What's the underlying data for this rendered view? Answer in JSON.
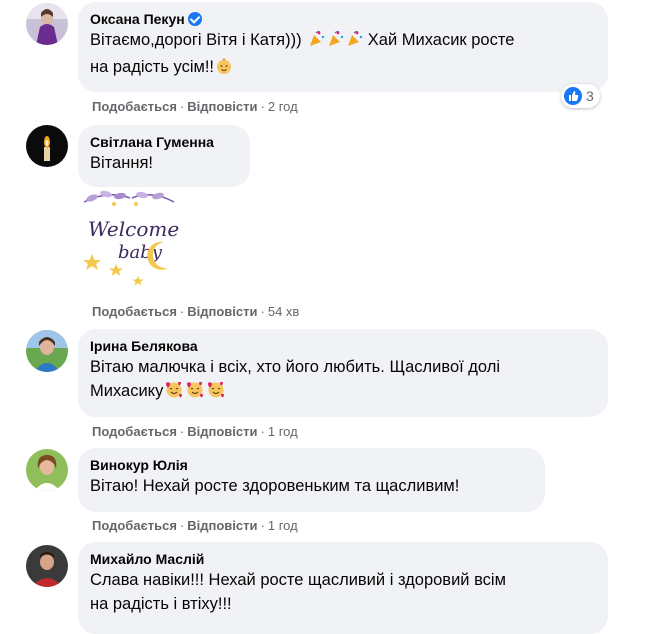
{
  "ui": {
    "like_label": "Подобається",
    "reply_label": "Відповісти",
    "dot": "·"
  },
  "colors": {
    "bubble_bg": "#f0f2f5",
    "meta_text": "#65676b",
    "verified_blue": "#1877f2"
  },
  "comments": [
    {
      "author": "Оксана Пекун",
      "verified": true,
      "line1": "Вітаємо,дорогі Вітя і Катя)))",
      "line1_tail": "Хай Михасик росте",
      "line2": "на радість усім!!",
      "time": "2 год",
      "reactions": "3",
      "emoji": [
        "party-popper-icon",
        "party-popper-icon",
        "party-popper-icon",
        "baby-face-icon"
      ]
    },
    {
      "author": "Світлана Гуменна",
      "line1": "Вітання!",
      "time": "54 хв",
      "sticker": {
        "line1": "Welcome",
        "line2": "baby"
      }
    },
    {
      "author": "Ірина Белякова",
      "line1": "Вітаю малючка і всіх, хто його любить. Щасливої долі",
      "line2": "Михасику",
      "time": "1 год",
      "emoji": [
        "smiling-face-with-hearts-icon",
        "smiling-face-with-hearts-icon",
        "smiling-face-with-hearts-icon"
      ]
    },
    {
      "author": "Винокур Юлія",
      "line1": "Вітаю! Нехай росте здоровеньким та щасливим!",
      "time": "1 год"
    },
    {
      "author": "Михайло Маслій",
      "line1": "Слава навіки!!! Нехай росте щасливий і здоровий всім",
      "line2": "на радість і втіху!!!"
    }
  ]
}
